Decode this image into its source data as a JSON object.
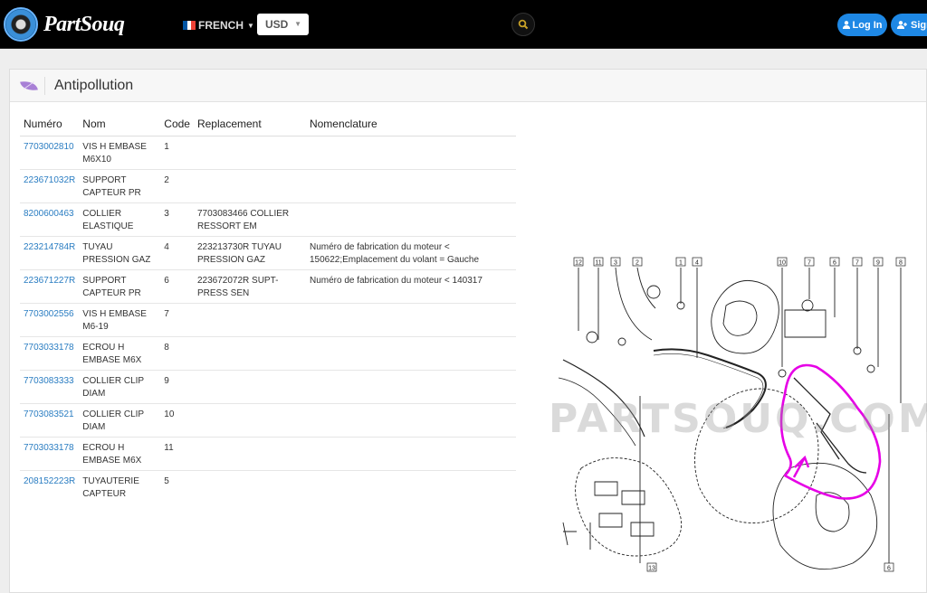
{
  "header": {
    "brand": "PartSouq",
    "language": "FRENCH",
    "currency": "USD",
    "login_label": "Log In",
    "signup_label": "Sign"
  },
  "section": {
    "title": "Antipollution",
    "icon": "leaf-icon"
  },
  "table": {
    "columns": [
      "Numéro",
      "Nom",
      "Code",
      "Replacement",
      "Nomenclature"
    ],
    "rows": [
      {
        "num": "7703002810",
        "nom": "VIS H EMBASE M6X10",
        "code": "1",
        "rep": "",
        "nomen": ""
      },
      {
        "num": "223671032R",
        "nom": "SUPPORT CAPTEUR PR",
        "code": "2",
        "rep": "",
        "nomen": ""
      },
      {
        "num": "8200600463",
        "nom": "COLLIER ELASTIQUE",
        "code": "3",
        "rep": "7703083466 COLLIER RESSORT EM",
        "nomen": ""
      },
      {
        "num": "223214784R",
        "nom": "TUYAU PRESSION GAZ",
        "code": "4",
        "rep": "223213730R TUYAU PRESSION GAZ",
        "nomen": "Numéro de fabrication du moteur < 150622;Emplacement du volant = Gauche"
      },
      {
        "num": "223671227R",
        "nom": "SUPPORT CAPTEUR PR",
        "code": "6",
        "rep": "223672072R SUPT-PRESS SEN",
        "nomen": "Numéro de fabrication du moteur < 140317"
      },
      {
        "num": "7703002556",
        "nom": "VIS H EMBASE M6-19",
        "code": "7",
        "rep": "",
        "nomen": ""
      },
      {
        "num": "7703033178",
        "nom": "ECROU H EMBASE M6X",
        "code": "8",
        "rep": "",
        "nomen": ""
      },
      {
        "num": "7703083333",
        "nom": "COLLIER CLIP DIAM",
        "code": "9",
        "rep": "",
        "nomen": ""
      },
      {
        "num": "7703083521",
        "nom": "COLLIER CLIP DIAM",
        "code": "10",
        "rep": "",
        "nomen": ""
      },
      {
        "num": "7703033178",
        "nom": "ECROU H EMBASE M6X",
        "code": "11",
        "rep": "",
        "nomen": ""
      },
      {
        "num": "208152223R",
        "nom": "TUYAUTERIE CAPTEUR",
        "code": "5",
        "rep": "",
        "nomen": ""
      }
    ]
  },
  "diagram": {
    "watermark": "PARTSOUQ.COM",
    "callouts": [
      "12",
      "11",
      "3",
      "2",
      "1",
      "4",
      "10",
      "7",
      "6",
      "7",
      "9",
      "8",
      "13",
      "6"
    ],
    "highlight_color": "#e600e6"
  }
}
